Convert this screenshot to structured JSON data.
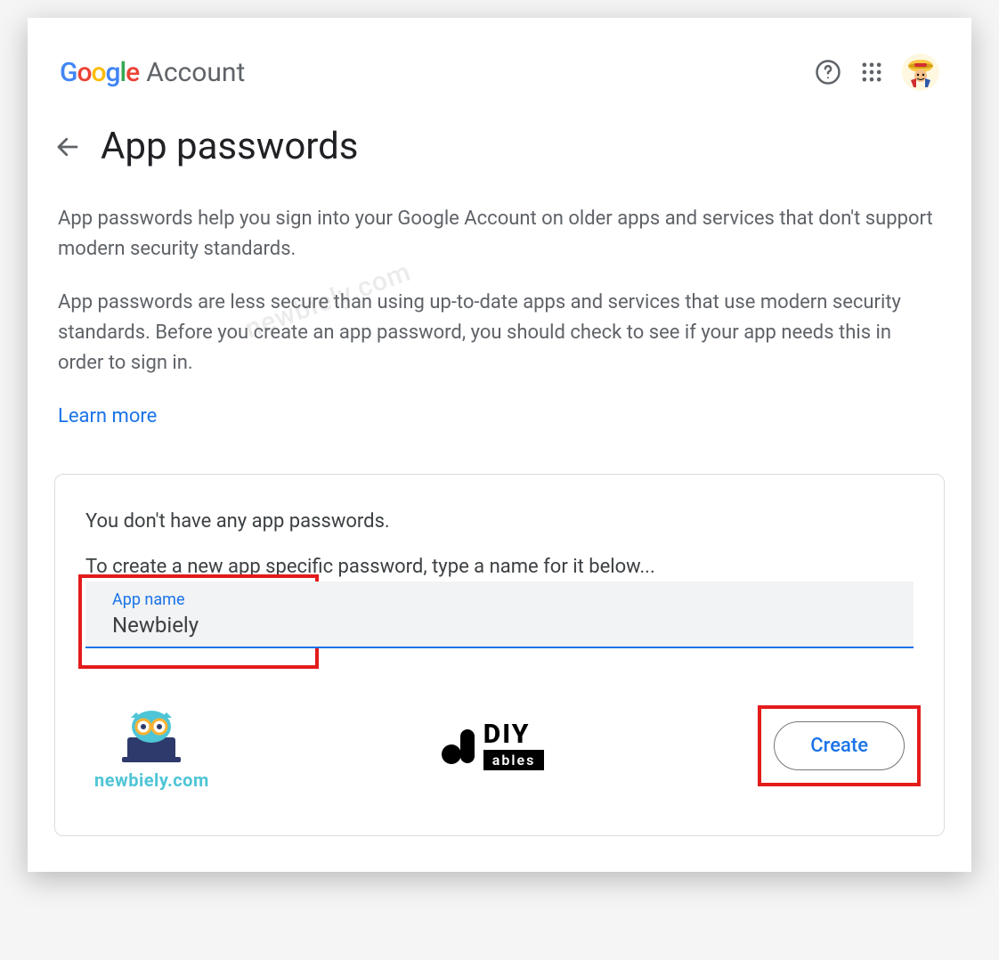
{
  "header": {
    "logo_text": "Google",
    "account_label": "Account"
  },
  "page": {
    "title": "App passwords",
    "paragraph1": "App passwords help you sign into your Google Account on older apps and services that don't support modern security standards.",
    "paragraph2": "App passwords are less secure than using up-to-date apps and services that use modern security standards. Before you create an app password, you should check to see if your app needs this in order to sign in.",
    "learn_more": "Learn more"
  },
  "card": {
    "no_passwords_text": "You don't have any app passwords.",
    "instruction_text": "To create a new app specific password, type a name for it below...",
    "input_label": "App name",
    "input_value": "Newbiely",
    "create_label": "Create"
  },
  "logos": {
    "newbiely": "newbiely.com",
    "diy_top": "DIY",
    "diy_bottom": "ables"
  },
  "watermark": "newbiely.com"
}
